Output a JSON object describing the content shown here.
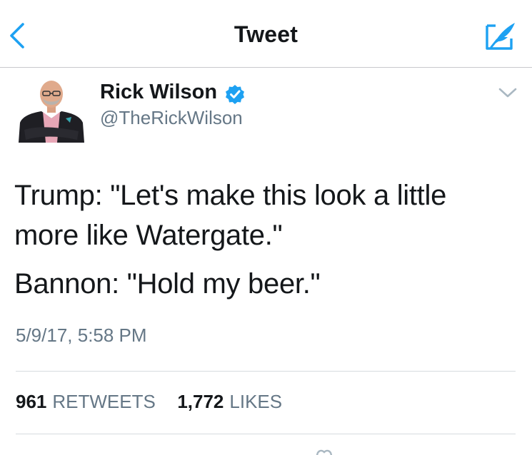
{
  "nav": {
    "title": "Tweet",
    "back_icon": "chevron-left-icon",
    "compose_icon": "compose-feather-icon"
  },
  "author": {
    "display_name": "Rick Wilson",
    "handle": "@TheRickWilson",
    "verified": true,
    "verified_icon": "verified-badge-icon",
    "menu_icon": "chevron-down-icon"
  },
  "tweet": {
    "line1": "Trump: \"Let's make this look a little more like Watergate.\"",
    "line2": "Bannon: \"Hold my beer.\"",
    "timestamp": "5/9/17, 5:58 PM"
  },
  "stats": {
    "retweets_count": "961",
    "retweets_label": "RETWEETS",
    "likes_count": "1,772",
    "likes_label": "LIKES"
  },
  "colors": {
    "accent": "#1da1f2",
    "text": "#14171a",
    "secondary": "#657786",
    "divider": "#d6dbdf"
  }
}
